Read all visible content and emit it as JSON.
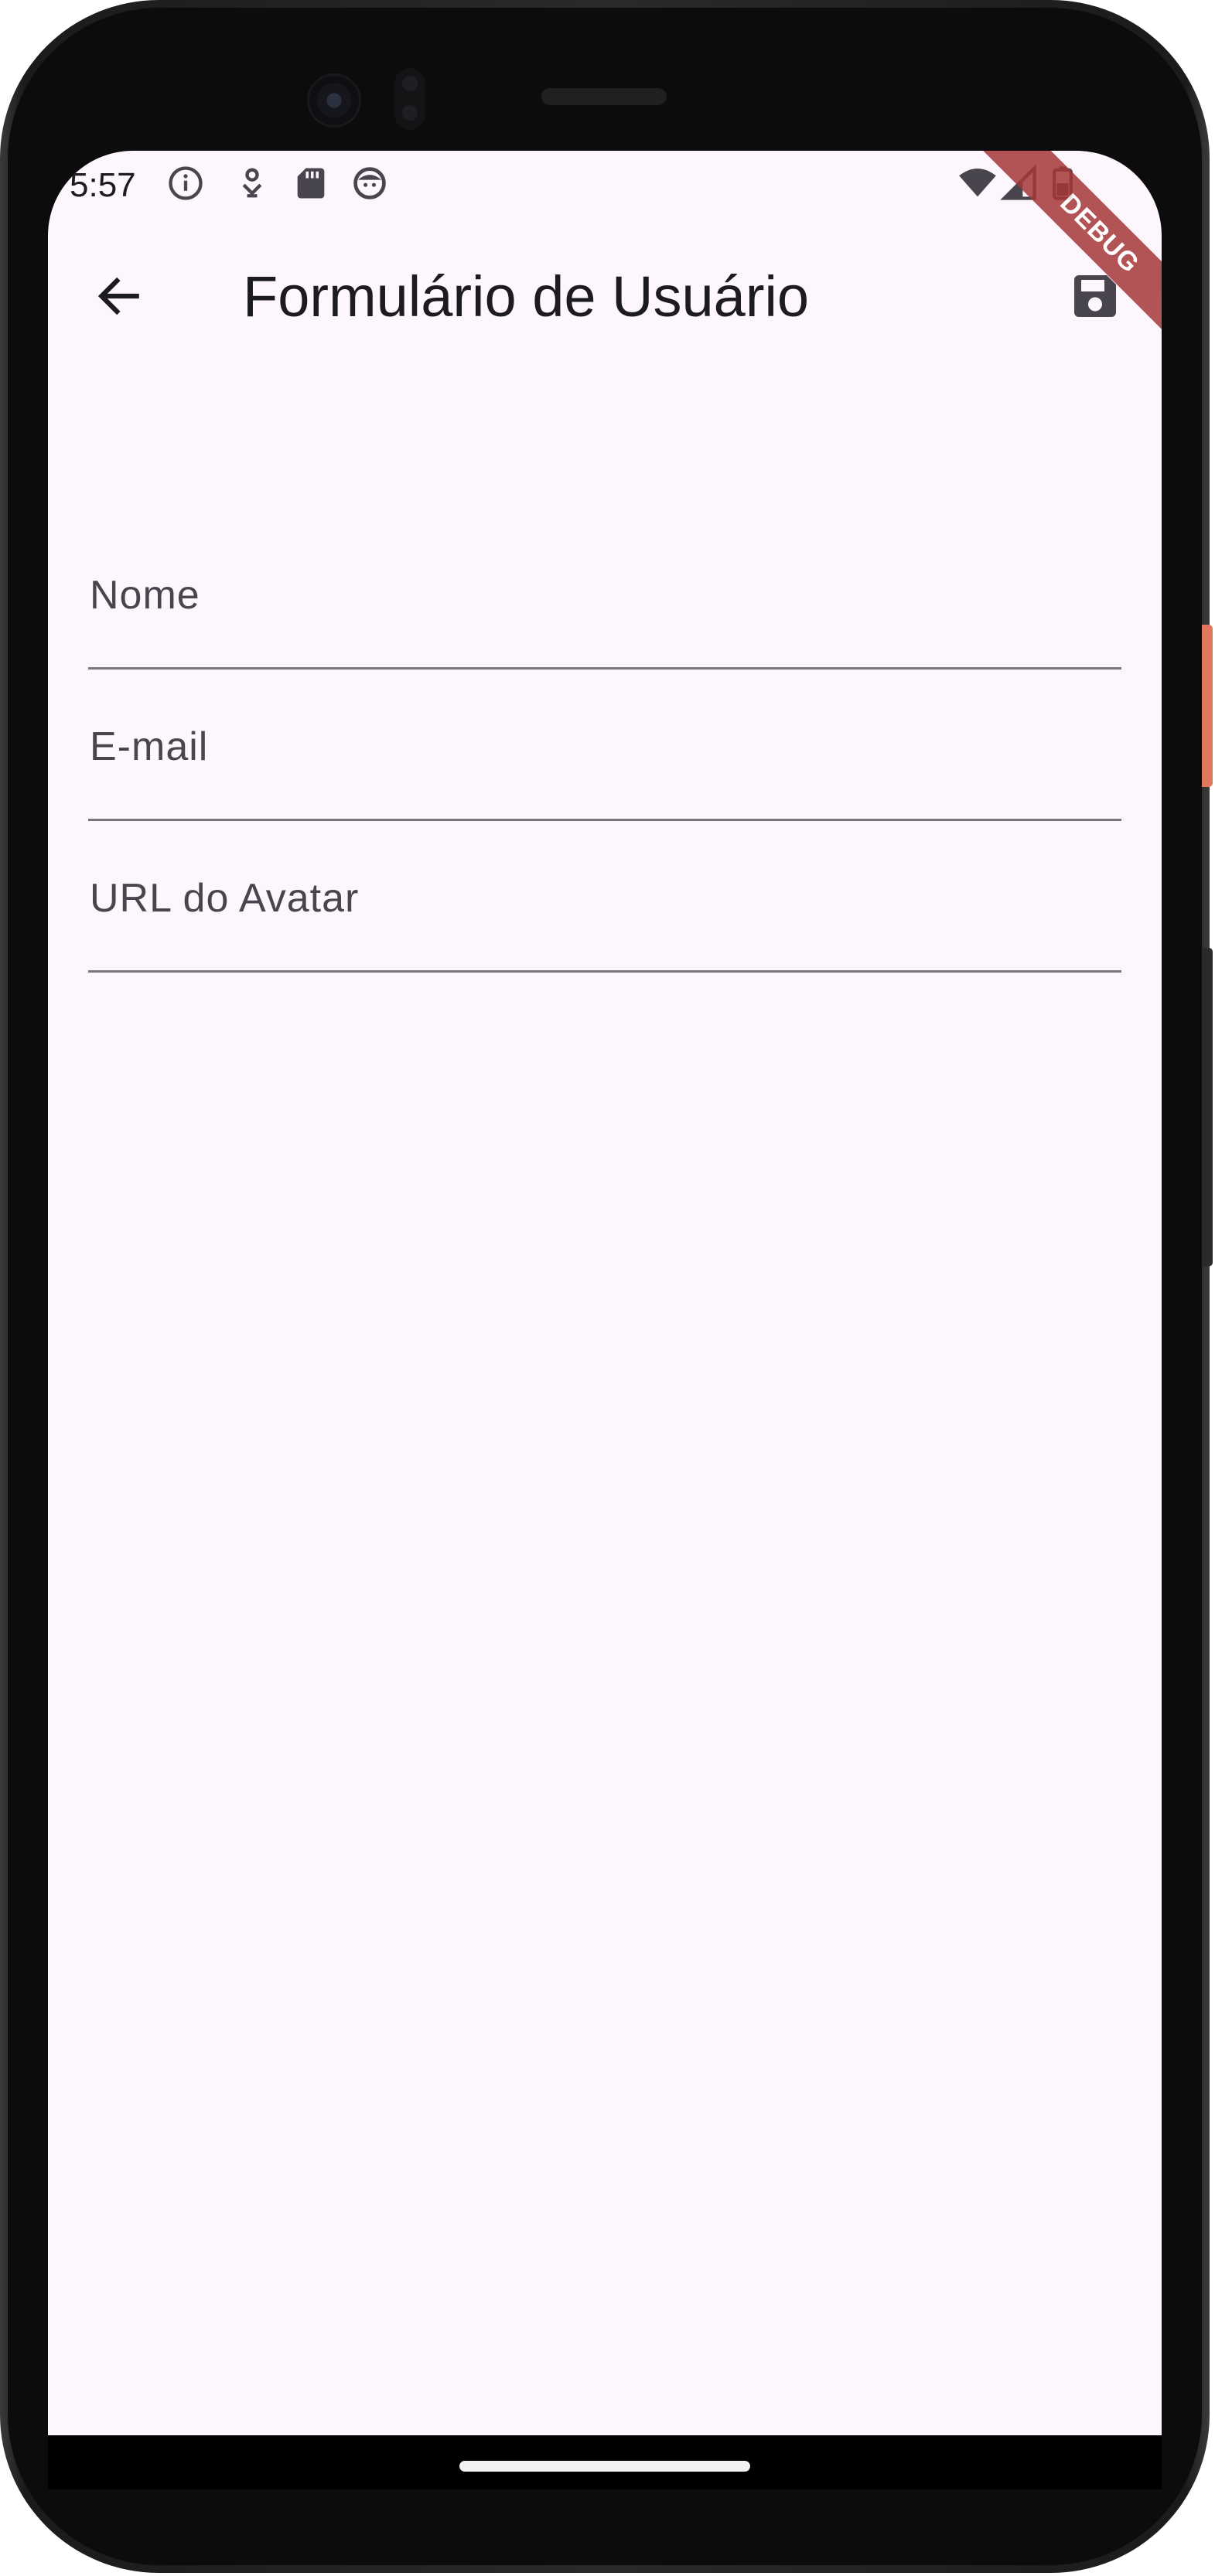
{
  "status_bar": {
    "time": "5:57",
    "left_icons": [
      "info-icon",
      "location-pin-icon",
      "sd-card-icon",
      "face-icon"
    ],
    "right_icons": [
      "wifi-icon",
      "signal-icon",
      "battery-icon"
    ]
  },
  "debug_banner": "DEBUG",
  "app_bar": {
    "back_icon": "arrow-back-icon",
    "title": "Formulário de Usuário",
    "action_icon": "save-icon"
  },
  "form": {
    "fields": [
      {
        "label": "Nome",
        "value": ""
      },
      {
        "label": "E-mail",
        "value": ""
      },
      {
        "label": "URL do Avatar",
        "value": ""
      }
    ]
  },
  "colors": {
    "background": "#fdf6fd",
    "text": "#1c1b1f",
    "label": "#49454f",
    "underline": "#79747e",
    "debug_banner": "#a53838"
  }
}
